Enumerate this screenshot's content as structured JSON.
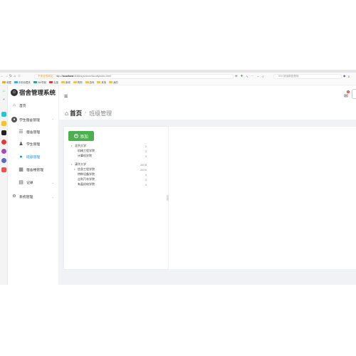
{
  "browser": {
    "security_label": "不安全的网站",
    "url_prefix": "http://",
    "url_host": "localhost",
    "url_path": ":8088/sys/dorm/facultyIndex.html",
    "search_placeholder": "500 错误原因是啥",
    "bookmarks": [
      "收藏",
      "手机收藏夹",
      "360导航",
      "百度",
      "新闻",
      "购物",
      "游戏",
      "其他",
      "我的"
    ]
  },
  "app": {
    "title": "宿舍管理系统"
  },
  "sidebar": {
    "home_label": "首页",
    "group_label": "学生宿舍管理",
    "items": [
      {
        "label": "宿舍管理",
        "icon": "list-icon"
      },
      {
        "label": "学生管理",
        "icon": "user-icon"
      },
      {
        "label": "班级管理",
        "icon": "class-icon"
      },
      {
        "label": "宿舍楼管理",
        "icon": "building-icon"
      },
      {
        "label": "记录",
        "icon": "record-icon"
      }
    ],
    "settings_label": "系统管理"
  },
  "header": {
    "mail_badge": "0"
  },
  "breadcrumb": {
    "home": "首页",
    "current": "班级管理"
  },
  "toolbar": {
    "add_label": "添加"
  },
  "tree": [
    {
      "label": "北京大学",
      "count": "2",
      "level": 0,
      "expanded": true
    },
    {
      "label": "机械工程学院",
      "count": "3",
      "level": 1
    },
    {
      "label": "计算机学院",
      "count": "3",
      "level": 1
    },
    {
      "label": "清华大学",
      "count": "2678",
      "level": 0,
      "expanded": true
    },
    {
      "label": "信息工程学院",
      "count": "2676",
      "level": 1,
      "expanded": true
    },
    {
      "label": "特种设备学院",
      "count": "3",
      "level": 1
    },
    {
      "label": "吉利汽车学院",
      "count": "3",
      "level": 1
    },
    {
      "label": "有晶机电学院",
      "count": "3",
      "level": 1
    }
  ],
  "colors": {
    "accent": "#1e88e5",
    "add_button": "#4caf50",
    "badge": "#e53935"
  }
}
